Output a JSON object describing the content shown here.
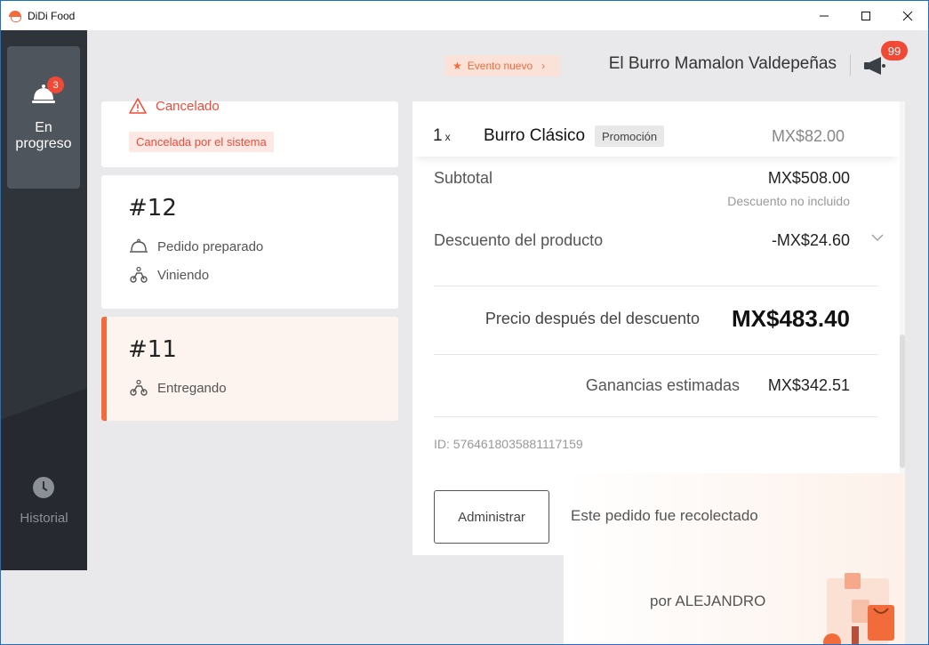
{
  "window": {
    "title": "DiDi Food",
    "minimize": "—",
    "maximize": "☐",
    "close": "✕"
  },
  "sidebar": {
    "items": [
      {
        "label": "En progreso",
        "badge": "3",
        "icon": "bell-icon",
        "active": true
      },
      {
        "label": "Historial",
        "icon": "clock-icon",
        "active": false
      }
    ]
  },
  "header": {
    "event_label": "Evento nuevo",
    "store_name": "El Burro Mamalon Valdepeñas",
    "notifications_badge": "99"
  },
  "orders": [
    {
      "status": "Cancelado",
      "tag": "Cancelada por el sistema"
    },
    {
      "number": "#12",
      "steps": [
        "Pedido preparado",
        "Viniendo"
      ]
    },
    {
      "number": "#11",
      "steps": [
        "Entregando"
      ],
      "selected": true
    }
  ],
  "detail": {
    "item": {
      "qty": "1",
      "qty_suffix": "x",
      "name": "Burro Clásico",
      "tag": "Promoción",
      "price": "MX$82.00"
    },
    "subtotal_label": "Subtotal",
    "subtotal_value": "MX$508.00",
    "subtotal_note": "Descuento no incluido",
    "discount_label": "Descuento del producto",
    "discount_value": "-MX$24.60",
    "final_label": "Precio después del descuento",
    "final_value": "MX$483.40",
    "earnings_label": "Ganancias estimadas",
    "earnings_value": "MX$342.51",
    "order_id": "ID: 5764618035881117159"
  },
  "actions": {
    "admin_button": "Administrar",
    "collected_text": "Este pedido fue recolectado",
    "by_text": "por ALEJANDRO"
  },
  "colors": {
    "accent": "#f26b3a",
    "badge": "#f04a37",
    "sidebar": "#2d3238"
  }
}
